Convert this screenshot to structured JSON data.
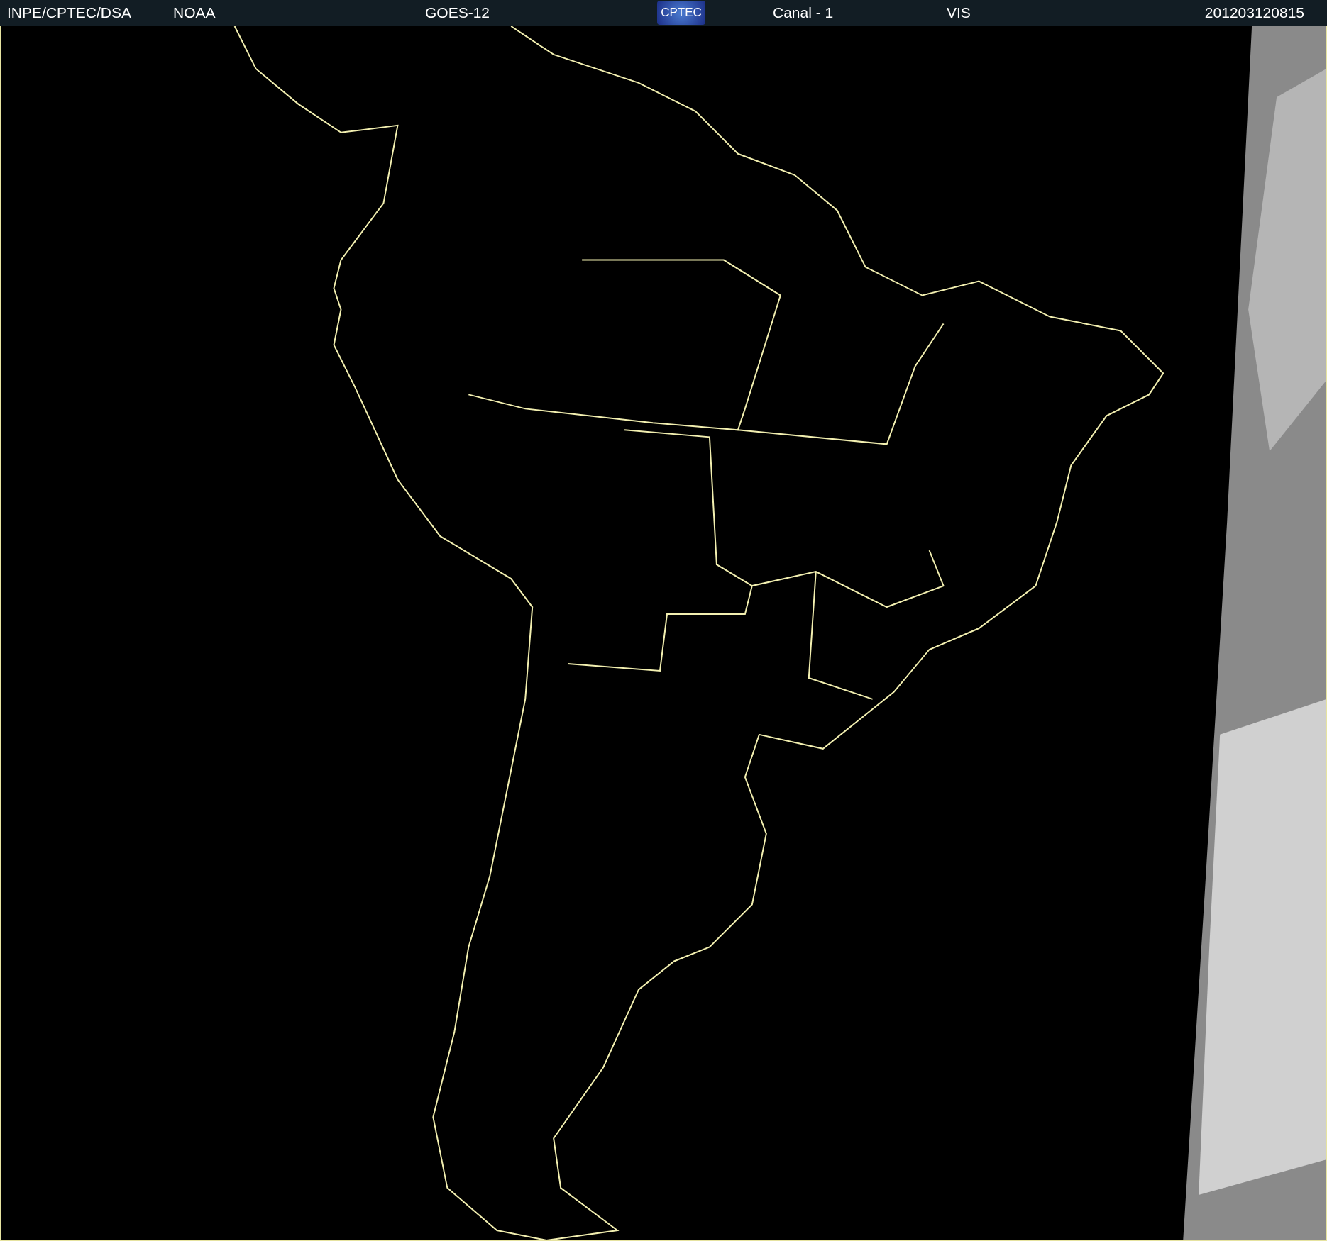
{
  "header": {
    "source": "INPE/CPTEC/DSA",
    "agency": "NOAA",
    "satellite": "GOES-12",
    "logo": "CPTEC",
    "channel": "Canal - 1",
    "band": "VIS",
    "timestamp": "201203120815"
  }
}
